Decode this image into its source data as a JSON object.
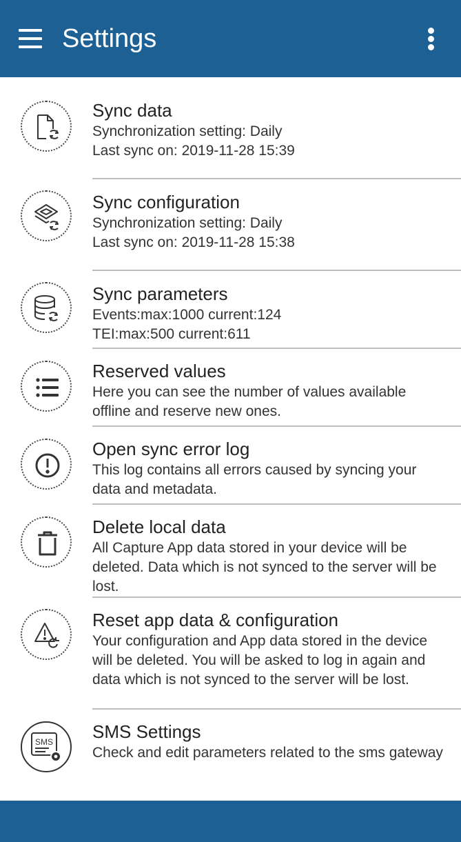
{
  "appbar": {
    "title": "Settings"
  },
  "items": [
    {
      "title": "Sync data",
      "line1": "Synchronization setting: Daily",
      "line2": "Last sync on: 2019-11-28 15:39"
    },
    {
      "title": "Sync configuration",
      "line1": "Synchronization setting: Daily",
      "line2": "Last sync on: 2019-11-28 15:38"
    },
    {
      "title": "Sync parameters",
      "line1": "Events:max:1000 current:124",
      "line2": "TEI:max:500 current:611"
    },
    {
      "title": "Reserved values",
      "desc": "Here you can see the number of values available offline and reserve new ones."
    },
    {
      "title": "Open sync error log",
      "desc": "This log contains all errors caused by syncing your data and metadata."
    },
    {
      "title": "Delete local data",
      "desc": "All Capture App data stored in your device will be deleted. Data which is not synced to the server will be lost."
    },
    {
      "title": "Reset app data & configuration",
      "desc": "Your configuration and App data stored in the device will be deleted. You will be asked to log in again and data which is not synced to the server will be lost."
    },
    {
      "title": "SMS Settings",
      "desc": "Check and edit parameters related to the sms gateway",
      "icon_text": "SMS"
    }
  ],
  "colors": {
    "primary": "#1d6094",
    "divider": "#bdbdbd"
  },
  "icons": [
    "menu-icon",
    "more-vert-icon",
    "sync-file-icon",
    "sync-layers-icon",
    "sync-database-icon",
    "list-icon",
    "error-icon",
    "trash-icon",
    "warning-reset-icon",
    "sms-settings-icon"
  ]
}
